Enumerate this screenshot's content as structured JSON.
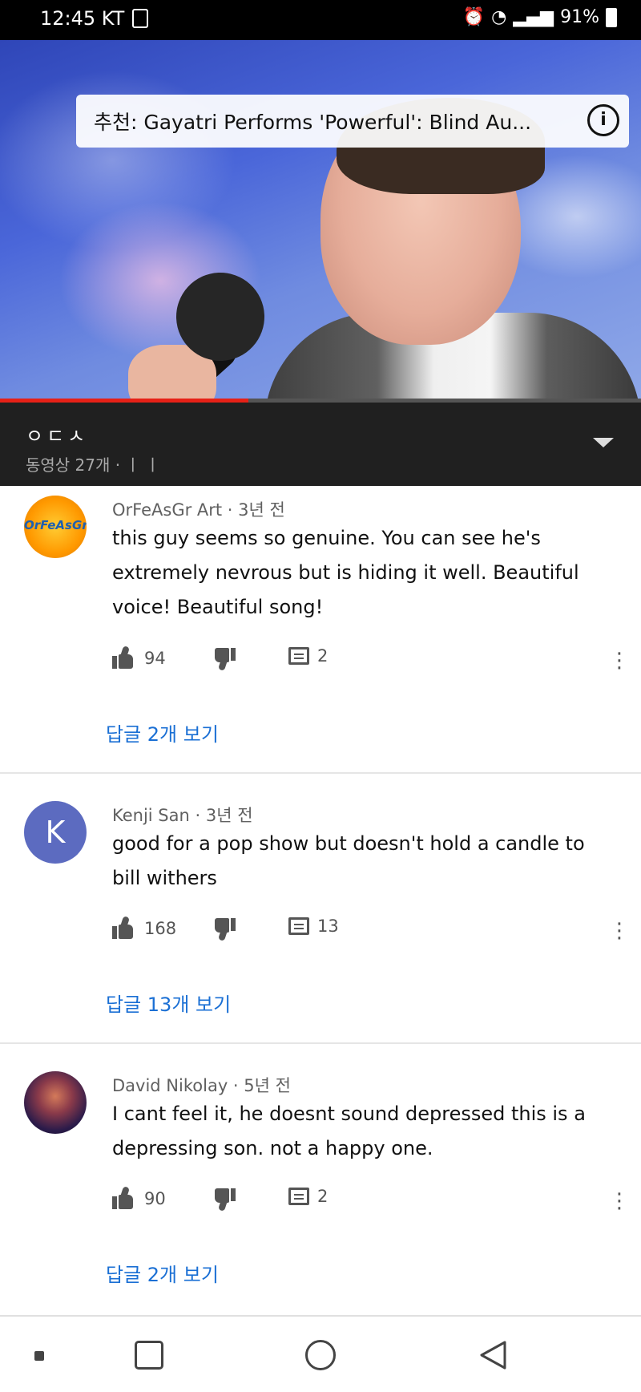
{
  "status_bar": {
    "time_carrier": "12:45 KT",
    "battery": "91%"
  },
  "video": {
    "recommendation": "추천: Gayatri Performs 'Powerful': Blind Au...",
    "info_icon": "i",
    "progress_percent": 38.8
  },
  "playlist": {
    "title": "ㅇㄷㅅ",
    "subtitle": "동영상 27개 · ㅣ ㅣ"
  },
  "comments": [
    {
      "meta": "OrFeAsGr Art · 3년 전",
      "avatar_text": "OrFeAsGr",
      "text": "this guy seems so genuine. You can see he's extremely nevrous but is hiding it well. Beautiful voice! Beautiful song!",
      "likes": "94",
      "replies_count": "2",
      "view_replies": "답글 2개 보기"
    },
    {
      "meta": "Kenji San · 3년 전",
      "avatar_text": "K",
      "text": "good for a pop show but doesn't hold a candle to bill withers",
      "likes": "168",
      "replies_count": "13",
      "view_replies": "답글 13개 보기"
    },
    {
      "meta": "David Nikolay · 5년 전",
      "text": "I cant feel it, he doesnt sound depressed this is a depressing son. not a happy one.",
      "likes": "90",
      "replies_count": "2",
      "view_replies": "답글 2개 보기"
    }
  ],
  "colors": {
    "accent_blue": "#1a6fd4",
    "progress_red": "#e62117",
    "playlist_bg": "#202020"
  }
}
